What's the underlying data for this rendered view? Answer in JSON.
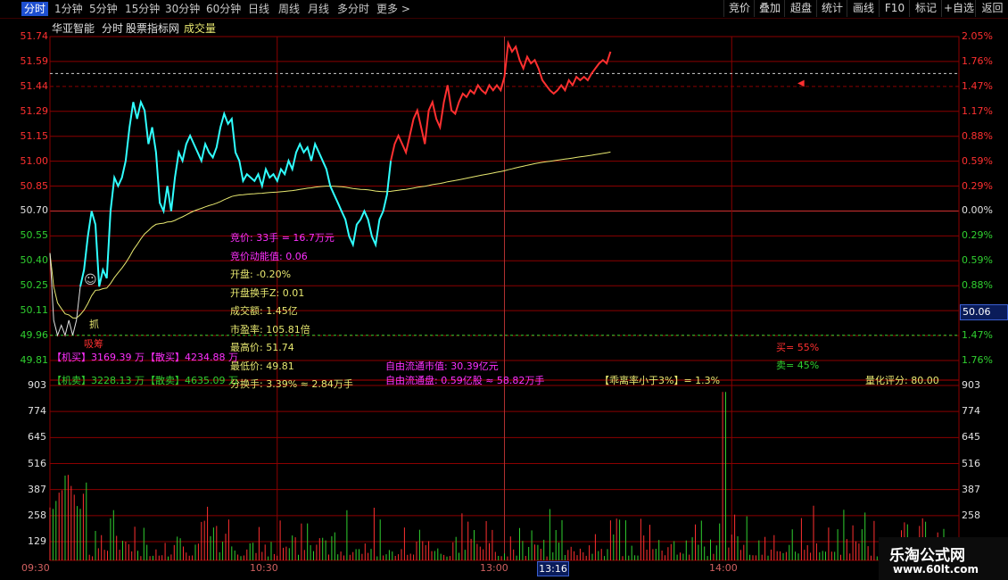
{
  "tabs": [
    "分时",
    "1分钟",
    "5分钟",
    "15分钟",
    "30分钟",
    "60分钟",
    "日线",
    "周线",
    "月线",
    "多分时",
    "更多 >"
  ],
  "toolbar": [
    "竞价",
    "叠加",
    "超盘",
    "统计",
    "画线",
    "F10",
    "标记",
    "+自选",
    "返回"
  ],
  "header": {
    "stock": "华亚智能",
    "period": "分时",
    "source": "股票指标网",
    "indicator": "成交量"
  },
  "price_axis": {
    "left": [
      "51.74",
      "51.59",
      "51.44",
      "51.29",
      "51.15",
      "51.00",
      "50.85",
      "50.70",
      "50.55",
      "50.40",
      "50.25",
      "50.11",
      "49.96",
      "49.81"
    ],
    "right": [
      "2.05%",
      "1.76%",
      "1.47%",
      "1.17%",
      "0.88%",
      "0.59%",
      "0.29%",
      "0.00%",
      "0.29%",
      "0.59%",
      "0.88%",
      "1.17%",
      "1.47%",
      "1.76%"
    ]
  },
  "volume_axis": [
    "903",
    "774",
    "645",
    "516",
    "387",
    "258",
    "129"
  ],
  "time_axis": [
    "09:30",
    "10:30",
    "13:00",
    "14:00"
  ],
  "cursor": {
    "price": "50.06",
    "time": "13:16"
  },
  "info_yellow": [
    "竞价: 33手 = 16.7万元",
    "竞价动能值: 0.06",
    "开盘: -0.20%",
    "开盘换手Z: 0.01",
    "成交额: 1.45亿",
    "市盈率: 105.81倍",
    "最高价: 51.74",
    "最低价: 49.81",
    "分换手: 3.39% ≈ 2.84万手"
  ],
  "info_labels": {
    "grab": "抓",
    "absorb": "吸筹",
    "inst_buy": "【机买】3169.39 万",
    "retail_buy": "【散买】4234.88 万",
    "inst_sell": "【机卖】3228.13 万",
    "retail_sell": "【散卖】4635.09 万",
    "float_value": "自由流通市值: 30.39亿元",
    "float_shares": "自由流通盘: 0.59亿股 ≈ 58.82万手",
    "deviation": "【乖离率小于3%】= 1.3%",
    "buy_pct": "买= 55%",
    "sell_pct": "卖= 45%",
    "score": "量化评分: 80.00"
  },
  "watermark": {
    "name": "乐淘公式网",
    "url": "www.60lt.com"
  },
  "colors": {
    "up": "#ff3030",
    "down": "#30ffff",
    "avg": "#e8e870",
    "magenta": "#ff30ff",
    "grid": "#8b0000",
    "green": "#30d030"
  },
  "chart_data": {
    "type": "line",
    "title": "",
    "prev_close": 50.7,
    "ylim": [
      49.81,
      51.74
    ],
    "xlim_minutes": [
      0,
      240
    ],
    "price": [
      [
        0,
        50.45
      ],
      [
        1,
        50.05
      ],
      [
        2,
        49.96
      ],
      [
        3,
        50.02
      ],
      [
        4,
        49.96
      ],
      [
        5,
        50.05
      ],
      [
        6,
        49.96
      ],
      [
        7,
        50.05
      ],
      [
        8,
        50.25
      ],
      [
        9,
        50.35
      ],
      [
        10,
        50.55
      ],
      [
        11,
        50.7
      ],
      [
        12,
        50.62
      ],
      [
        13,
        50.25
      ],
      [
        14,
        50.35
      ],
      [
        15,
        50.3
      ],
      [
        16,
        50.7
      ],
      [
        17,
        50.9
      ],
      [
        18,
        50.85
      ],
      [
        19,
        50.9
      ],
      [
        20,
        51.0
      ],
      [
        21,
        51.2
      ],
      [
        22,
        51.35
      ],
      [
        23,
        51.25
      ],
      [
        24,
        51.35
      ],
      [
        25,
        51.3
      ],
      [
        26,
        51.1
      ],
      [
        27,
        51.2
      ],
      [
        28,
        51.05
      ],
      [
        29,
        50.75
      ],
      [
        30,
        50.7
      ],
      [
        31,
        50.85
      ],
      [
        32,
        50.7
      ],
      [
        33,
        50.9
      ],
      [
        34,
        51.05
      ],
      [
        35,
        51.0
      ],
      [
        36,
        51.1
      ],
      [
        37,
        51.15
      ],
      [
        38,
        51.1
      ],
      [
        39,
        51.05
      ],
      [
        40,
        51.0
      ],
      [
        41,
        51.1
      ],
      [
        42,
        51.05
      ],
      [
        43,
        51.02
      ],
      [
        44,
        51.08
      ],
      [
        45,
        51.2
      ],
      [
        46,
        51.28
      ],
      [
        47,
        51.22
      ],
      [
        48,
        51.25
      ],
      [
        49,
        51.05
      ],
      [
        50,
        51.0
      ],
      [
        51,
        50.88
      ],
      [
        52,
        50.92
      ],
      [
        53,
        50.9
      ],
      [
        54,
        50.88
      ],
      [
        55,
        50.92
      ],
      [
        56,
        50.85
      ],
      [
        57,
        50.95
      ],
      [
        58,
        50.9
      ],
      [
        59,
        50.92
      ],
      [
        60,
        50.88
      ],
      [
        61,
        50.95
      ],
      [
        62,
        50.92
      ],
      [
        63,
        51.0
      ],
      [
        64,
        50.95
      ],
      [
        65,
        51.05
      ],
      [
        66,
        51.1
      ],
      [
        67,
        51.05
      ],
      [
        68,
        51.08
      ],
      [
        69,
        51.0
      ],
      [
        70,
        51.1
      ],
      [
        71,
        51.05
      ],
      [
        72,
        51.0
      ],
      [
        73,
        50.95
      ],
      [
        74,
        50.85
      ],
      [
        75,
        50.8
      ],
      [
        76,
        50.75
      ],
      [
        77,
        50.7
      ],
      [
        78,
        50.65
      ],
      [
        79,
        50.55
      ],
      [
        80,
        50.5
      ],
      [
        81,
        50.62
      ],
      [
        82,
        50.65
      ],
      [
        83,
        50.7
      ],
      [
        84,
        50.65
      ],
      [
        85,
        50.55
      ],
      [
        86,
        50.5
      ],
      [
        87,
        50.65
      ],
      [
        88,
        50.7
      ],
      [
        89,
        50.8
      ],
      [
        90,
        51.0
      ],
      [
        91,
        51.1
      ],
      [
        92,
        51.15
      ],
      [
        93,
        51.1
      ],
      [
        94,
        51.05
      ],
      [
        95,
        51.15
      ],
      [
        96,
        51.25
      ],
      [
        97,
        51.3
      ],
      [
        98,
        51.2
      ],
      [
        99,
        51.1
      ],
      [
        100,
        51.3
      ],
      [
        101,
        51.35
      ],
      [
        102,
        51.25
      ],
      [
        103,
        51.2
      ],
      [
        104,
        51.35
      ],
      [
        105,
        51.45
      ],
      [
        106,
        51.3
      ],
      [
        107,
        51.28
      ],
      [
        108,
        51.35
      ],
      [
        109,
        51.4
      ],
      [
        110,
        51.38
      ],
      [
        111,
        51.42
      ],
      [
        112,
        51.4
      ],
      [
        113,
        51.45
      ],
      [
        114,
        51.42
      ],
      [
        115,
        51.4
      ],
      [
        116,
        51.45
      ],
      [
        117,
        51.42
      ],
      [
        118,
        51.45
      ],
      [
        119,
        51.42
      ],
      [
        120,
        51.5
      ],
      [
        121,
        51.7
      ],
      [
        122,
        51.65
      ],
      [
        123,
        51.68
      ],
      [
        124,
        51.6
      ],
      [
        125,
        51.55
      ],
      [
        126,
        51.62
      ],
      [
        127,
        51.58
      ],
      [
        128,
        51.6
      ],
      [
        129,
        51.55
      ],
      [
        130,
        51.48
      ],
      [
        131,
        51.45
      ],
      [
        132,
        51.42
      ],
      [
        133,
        51.4
      ],
      [
        134,
        51.42
      ],
      [
        135,
        51.45
      ],
      [
        136,
        51.42
      ],
      [
        137,
        51.48
      ],
      [
        138,
        51.45
      ],
      [
        139,
        51.5
      ],
      [
        140,
        51.48
      ],
      [
        141,
        51.5
      ],
      [
        142,
        51.48
      ],
      [
        143,
        51.52
      ],
      [
        144,
        51.55
      ],
      [
        145,
        51.58
      ],
      [
        146,
        51.6
      ],
      [
        147,
        51.58
      ],
      [
        148,
        51.65
      ]
    ]
  }
}
